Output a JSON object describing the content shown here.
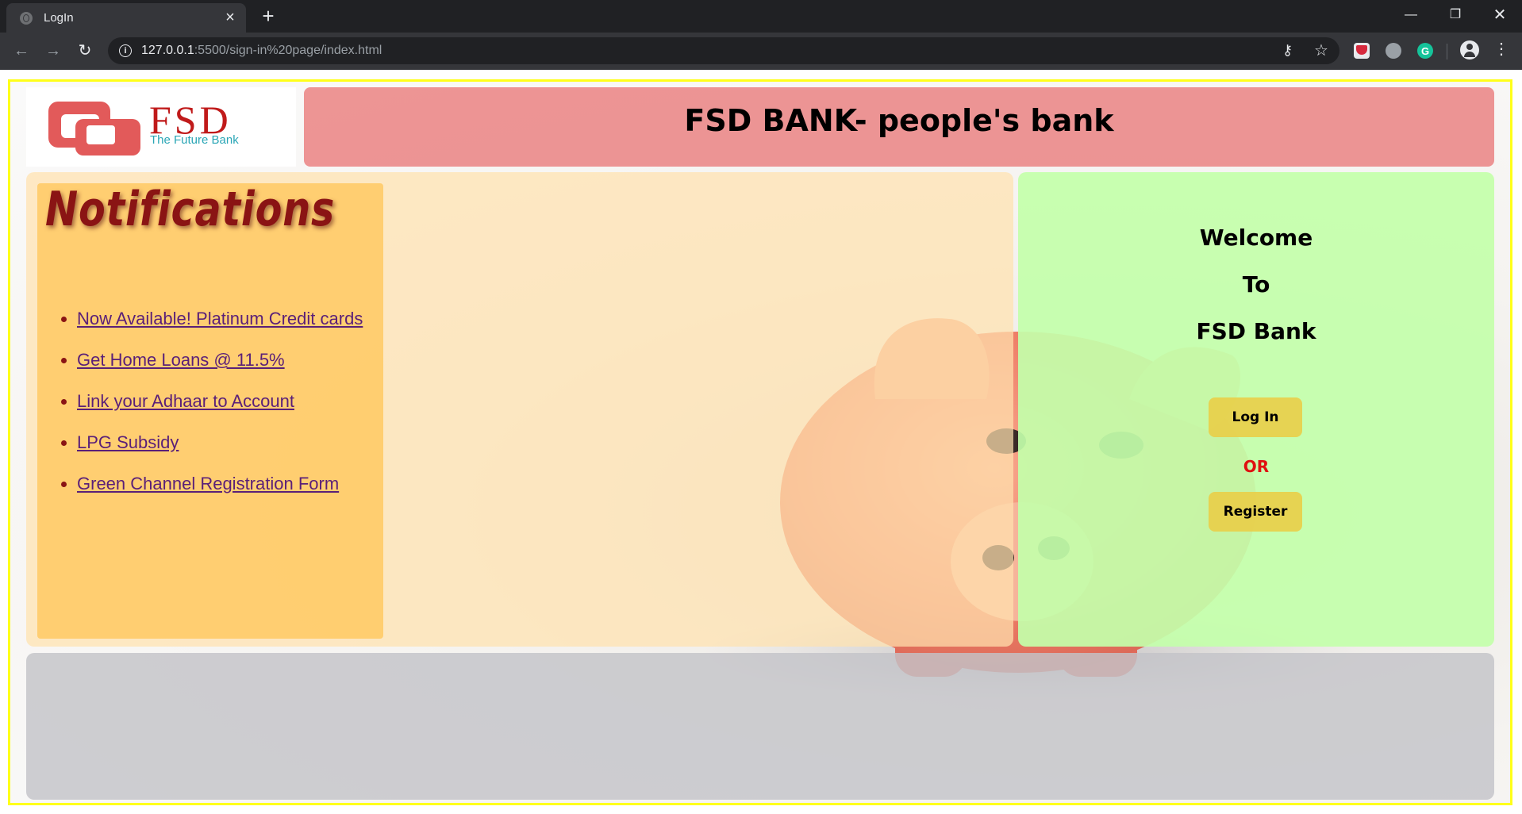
{
  "browser": {
    "tab_title": "LogIn",
    "url_host": "127.0.0.1",
    "url_rest": ":5500/sign-in%20page/index.html"
  },
  "logo": {
    "brand": "FSD",
    "tagline": "The Future Bank"
  },
  "header": {
    "title": "FSD BANK- people's bank"
  },
  "notifications": {
    "heading": "Notifications",
    "items": [
      "Now Available! Platinum Credit cards",
      "Get Home Loans @ 11.5%",
      "Link your Adhaar to Account",
      "LPG Subsidy",
      "Green Channel Registration Form"
    ]
  },
  "welcome": {
    "line1": "Welcome",
    "line2": "To",
    "line3": "FSD Bank",
    "login_label": "Log In",
    "or_label": "OR",
    "register_label": "Register"
  },
  "colors": {
    "header_bg": "#e97878",
    "notif_bg": "#ffc75a",
    "welcome_bg": "#c3ffaa",
    "button_bg": "#ebcd46",
    "or_text": "#e01010",
    "frame_border": "#ffff1a"
  }
}
